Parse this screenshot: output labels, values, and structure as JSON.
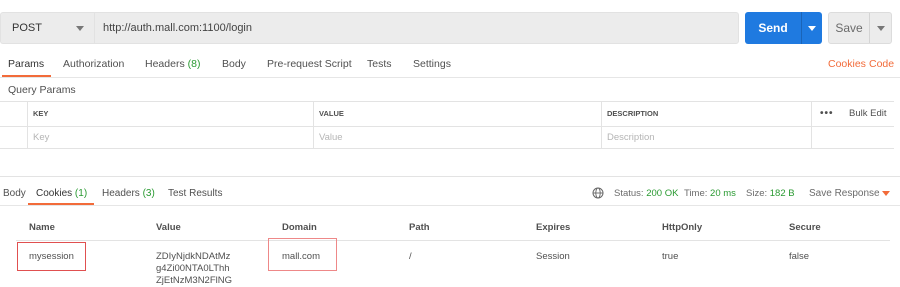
{
  "request": {
    "method": "POST",
    "url": "http://auth.mall.com:1100/login",
    "send_label": "Send",
    "save_label": "Save"
  },
  "request_tabs": {
    "params": "Params",
    "authorization": "Authorization",
    "headers": "Headers",
    "headers_count": "(8)",
    "body": "Body",
    "prerequest": "Pre-request Script",
    "tests": "Tests",
    "settings": "Settings",
    "cookies_link": "Cookies",
    "code_link": "Code"
  },
  "query_params": {
    "title": "Query Params",
    "columns": [
      "KEY",
      "VALUE",
      "DESCRIPTION"
    ],
    "more_label": "•••",
    "bulk_edit": "Bulk Edit",
    "placeholders": [
      "Key",
      "Value",
      "Description"
    ]
  },
  "response_tabs": {
    "body": "Body",
    "cookies": "Cookies",
    "cookies_count": "(1)",
    "headers": "Headers",
    "headers_count": "(3)",
    "test_results": "Test Results"
  },
  "response_status": {
    "status_label": "Status:",
    "status_value": "200 OK",
    "time_label": "Time:",
    "time_value": "20 ms",
    "size_label": "Size:",
    "size_value": "182 B",
    "save_response": "Save Response"
  },
  "cookies_table": {
    "columns": [
      "Name",
      "Value",
      "Domain",
      "Path",
      "Expires",
      "HttpOnly",
      "Secure"
    ],
    "rows": [
      {
        "name": "mysession",
        "value_lines": [
          "ZDIyNjdkNDAtMz",
          "g4Zi00NTA0LThh",
          "ZjEtNzM3N2FlNG"
        ],
        "domain": "mall.com",
        "path": "/",
        "expires": "Session",
        "httponly": "true",
        "secure": "false"
      }
    ]
  },
  "colors": {
    "accent": "#f26b3a",
    "send_blue": "#1f7ae0",
    "status_green": "#2a9a32",
    "highlight_red": "#e05050"
  },
  "icons": [
    "chevron-down-icon",
    "globe-icon",
    "more-icon"
  ]
}
